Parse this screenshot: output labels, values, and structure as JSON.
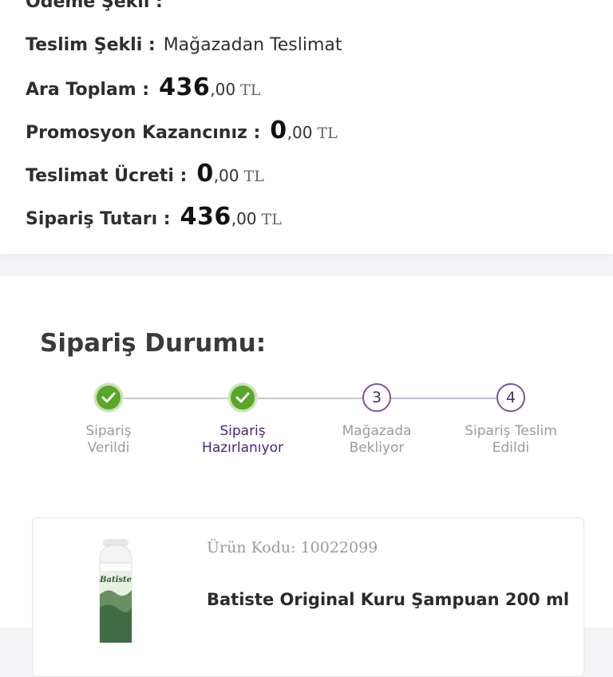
{
  "summary": {
    "payment": {
      "label": "Ödeme Şekli :"
    },
    "delivery": {
      "label": "Teslim Şekli :",
      "value": "Mağazadan Teslimat"
    },
    "subtotal": {
      "label": "Ara Toplam :",
      "int": "436",
      "dec": ",00",
      "cur": "TL"
    },
    "promotion": {
      "label": "Promosyon Kazancınız :",
      "int": "0",
      "dec": ",00",
      "cur": "TL"
    },
    "shipping": {
      "label": "Teslimat Ücreti :",
      "int": "0",
      "dec": ",00",
      "cur": "TL"
    },
    "total": {
      "label": "Sipariş Tutarı :",
      "int": "436",
      "dec": ",00",
      "cur": "TL"
    }
  },
  "order_status": {
    "title": "Sipariş Durumu:",
    "steps": [
      {
        "label": "Sipariş\nVerildi",
        "state": "done",
        "icon": "check-icon"
      },
      {
        "label": "Sipariş\nHazırlanıyor",
        "state": "done",
        "icon": "check-icon"
      },
      {
        "label": "Mağazada\nBekliyor",
        "state": "pending",
        "number": "3"
      },
      {
        "label": "Sipariş Teslim\nEdildi",
        "state": "pending",
        "number": "4"
      }
    ]
  },
  "product": {
    "code": "Ürün Kodu: 10022099",
    "name": "Batiste Original Kuru Şampuan 200 ml",
    "image_brand": "Batiste"
  },
  "colors": {
    "done": "#5aa629",
    "pending_border": "#7d5596",
    "active_label": "#4b2380",
    "inactive_label": "#9a9aa2"
  }
}
